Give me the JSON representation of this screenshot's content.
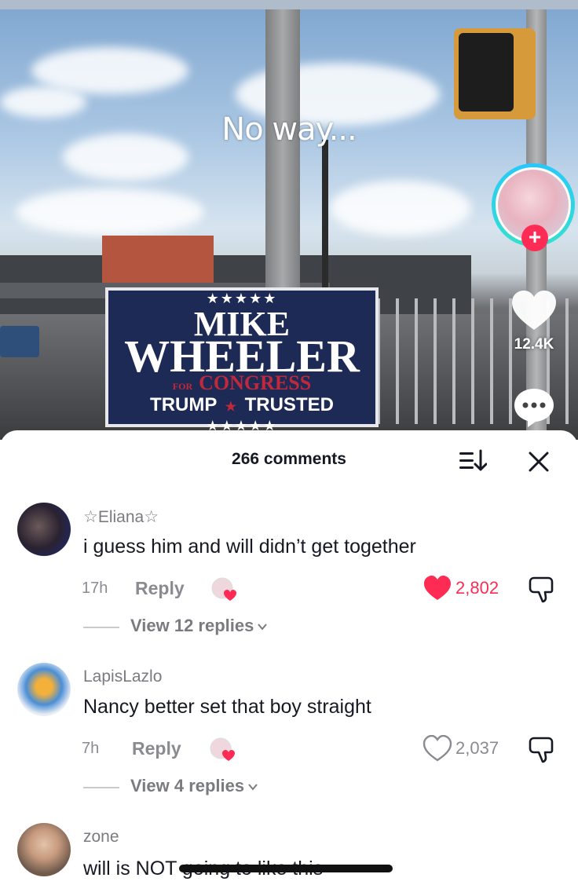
{
  "video": {
    "caption": "No way...",
    "sign": {
      "stars_top": "★★★★★",
      "first_name": "MIKE",
      "last_name": "WHEELER",
      "for": "FOR",
      "office": "CONGRESS",
      "slogan_left": "TRUMP",
      "slogan_sep": "★",
      "slogan_right": "TRUSTED",
      "stars_bottom": "★★★★★"
    },
    "follow_label": "+",
    "like_count": "12.4K",
    "colors": {
      "accent": "#fe2c55",
      "ring": "#26c6ff"
    }
  },
  "comments_panel": {
    "title": "266 comments",
    "sort_icon": "sort-icon",
    "close_icon": "close-icon"
  },
  "comments": [
    {
      "username": "☆Eliana☆",
      "text": "i guess him and will didn’t get together",
      "time": "17h",
      "reply_label": "Reply",
      "likes": "2,802",
      "liked": true,
      "view_replies": "View 12 replies"
    },
    {
      "username": "LapisLazlo",
      "text": "Nancy better set that boy straight",
      "time": "7h",
      "reply_label": "Reply",
      "likes": "2,037",
      "liked": false,
      "view_replies": "View 4 replies"
    },
    {
      "username": "zone",
      "text": "will is NOT going to like this"
    }
  ]
}
